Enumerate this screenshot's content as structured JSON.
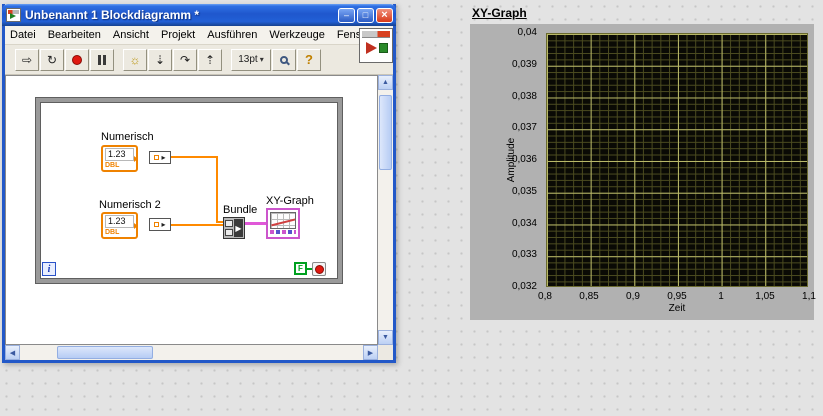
{
  "colors": {
    "titlebar_blue": "#2258c8",
    "numeric_orange": "#ef8200",
    "wire_orange": "#ff8a00",
    "cluster_pink": "#e058d8",
    "boolean_green": "#00a020",
    "abort_red": "#e01810",
    "plot_background": "#000000",
    "grid_major": "#b9b969",
    "grid_minor": "#4c4c20",
    "panel_gray": "#b1b1b1"
  },
  "window": {
    "title": "Unbenannt 1 Blockdiagramm *",
    "menu_items": [
      "Datei",
      "Bearbeiten",
      "Ansicht",
      "Projekt",
      "Ausführen",
      "Werkzeuge",
      "Fenster"
    ],
    "toolbar": {
      "font_label": "13pt",
      "help_label": "?"
    },
    "diagram": {
      "numeric1": {
        "label": "Numerisch",
        "value": "1.23",
        "type": "DBL"
      },
      "numeric2": {
        "label": "Numerisch 2",
        "value": "1.23",
        "type": "DBL"
      },
      "bundle_label": "Bundle",
      "xygraph_label": "XY-Graph",
      "iteration_label": "i",
      "stop_constant_label": "F"
    }
  },
  "graph": {
    "title": "XY-Graph",
    "ylabel": "Amplitude",
    "xlabel": "Zeit",
    "y_ticks": [
      "0,04",
      "0,039",
      "0,038",
      "0,037",
      "0,036",
      "0,035",
      "0,034",
      "0,033",
      "0,032"
    ],
    "x_ticks": [
      "0,8",
      "0,85",
      "0,9",
      "0,95",
      "1",
      "1,05",
      "1,1"
    ]
  },
  "chart_data": {
    "type": "line",
    "title": "XY-Graph",
    "xlabel": "Zeit",
    "ylabel": "Amplitude",
    "xlim": [
      0.8,
      1.1
    ],
    "ylim": [
      0.032,
      0.04
    ],
    "x_tick_values": [
      0.8,
      0.85,
      0.9,
      0.95,
      1,
      1.05,
      1.1
    ],
    "y_tick_values": [
      0.032,
      0.033,
      0.034,
      0.035,
      0.036,
      0.037,
      0.038,
      0.039,
      0.04
    ],
    "grid": true,
    "legend": false,
    "series": []
  }
}
